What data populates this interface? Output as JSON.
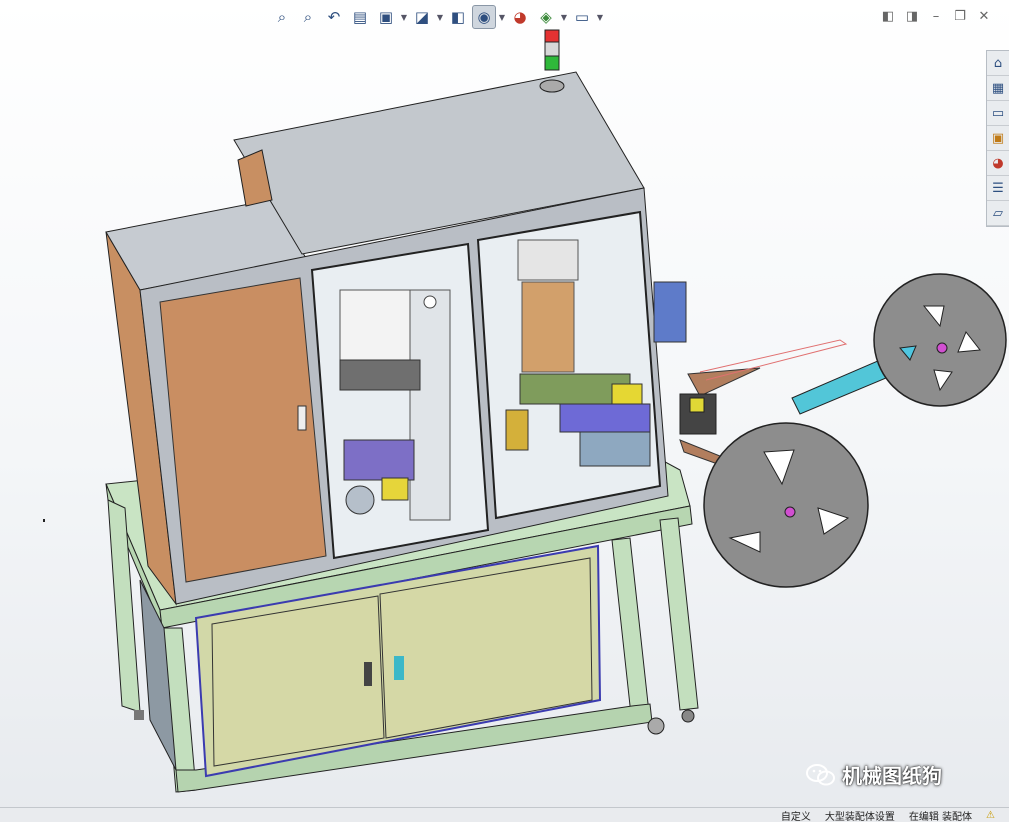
{
  "toolbar": {
    "buttons": [
      {
        "icon": "zoom-to-fit-icon",
        "glyph": "⌕"
      },
      {
        "icon": "zoom-to-area-icon",
        "glyph": "⌕"
      },
      {
        "icon": "previous-view-icon",
        "glyph": "↶"
      },
      {
        "icon": "section-view-icon",
        "glyph": "▤"
      },
      {
        "icon": "dynamic-annotation-icon",
        "glyph": "▣"
      },
      {
        "icon": "view-orientation-icon",
        "glyph": "◪"
      },
      {
        "icon": "display-style-icon",
        "glyph": "◧"
      },
      {
        "icon": "hide-show-items-icon",
        "glyph": "◉"
      },
      {
        "icon": "edit-appearance-icon",
        "glyph": "◕"
      },
      {
        "icon": "apply-scene-icon",
        "glyph": "◈"
      },
      {
        "icon": "view-settings-icon",
        "glyph": "▭"
      }
    ]
  },
  "window_controls": [
    {
      "icon": "tile-left-icon",
      "glyph": "◧"
    },
    {
      "icon": "tile-right-icon",
      "glyph": "◨"
    },
    {
      "icon": "minimize-icon",
      "glyph": "–"
    },
    {
      "icon": "restore-icon",
      "glyph": "❐"
    },
    {
      "icon": "close-icon",
      "glyph": "✕"
    }
  ],
  "task_pane": [
    {
      "icon": "home-icon",
      "glyph": "⌂"
    },
    {
      "icon": "parts-library-icon",
      "glyph": "▦"
    },
    {
      "icon": "file-explorer-icon",
      "glyph": "▭"
    },
    {
      "icon": "view-palette-icon",
      "glyph": "▣"
    },
    {
      "icon": "appearances-icon",
      "glyph": "◕"
    },
    {
      "icon": "custom-properties-icon",
      "glyph": "☰"
    },
    {
      "icon": "forum-icon",
      "glyph": "▱"
    }
  ],
  "status": {
    "custom": "自定义",
    "large_assembly": "大型装配体设置",
    "editing": "在编辑 装配体"
  },
  "watermark": {
    "text": "机械图纸狗"
  }
}
